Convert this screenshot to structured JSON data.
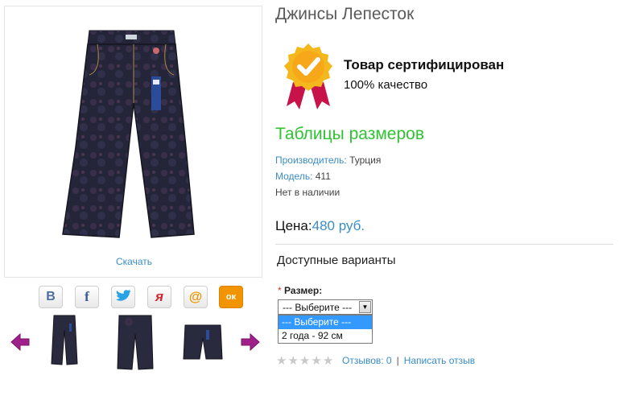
{
  "product": {
    "title": "Джинсы Лепесток",
    "download_label": "Скачать",
    "certified_title": "Товар сертифицирован",
    "certified_sub": "100% качество",
    "size_table_link": "Таблицы размеров",
    "manufacturer_label": "Производитель:",
    "manufacturer_value": "Турция",
    "model_label": "Модель:",
    "model_value": "411",
    "availability": "Нет в наличии",
    "price_label": "Цена:",
    "price_value": "480 руб."
  },
  "social": [
    {
      "icon": "vkontakte-icon",
      "glyph": "В",
      "color": "#4d6f9e"
    },
    {
      "icon": "facebook-icon",
      "glyph": "f",
      "color": "#3b5998"
    },
    {
      "icon": "twitter-icon",
      "glyph": "🐦",
      "color": "#2aa3e6"
    },
    {
      "icon": "yaru-icon",
      "glyph": "я",
      "color": "#d4262e"
    },
    {
      "icon": "mailru-icon",
      "glyph": "@",
      "color": "#f29400"
    },
    {
      "icon": "odnoklassniki-icon",
      "glyph": "ок",
      "color": "#ee8208"
    }
  ],
  "options": {
    "heading": "Доступные варианты",
    "required_mark": "*",
    "size_label": "Размер:",
    "select_value": "--- Выберите ---",
    "dropdown_options": [
      "--- Выберите ---",
      "2 года - 92 см"
    ],
    "selected_index": 0
  },
  "reviews": {
    "rating_stars": 0,
    "rating_max": 5,
    "count_label": "Отзывов: 0",
    "separator": "|",
    "write_label": "Написать отзыв"
  },
  "colors": {
    "link": "#3a8cc4",
    "accent_green": "#2fc232",
    "arrow": "#a0208a",
    "badge_gold": "#f4b81c",
    "ribbon": "#c8124a"
  }
}
